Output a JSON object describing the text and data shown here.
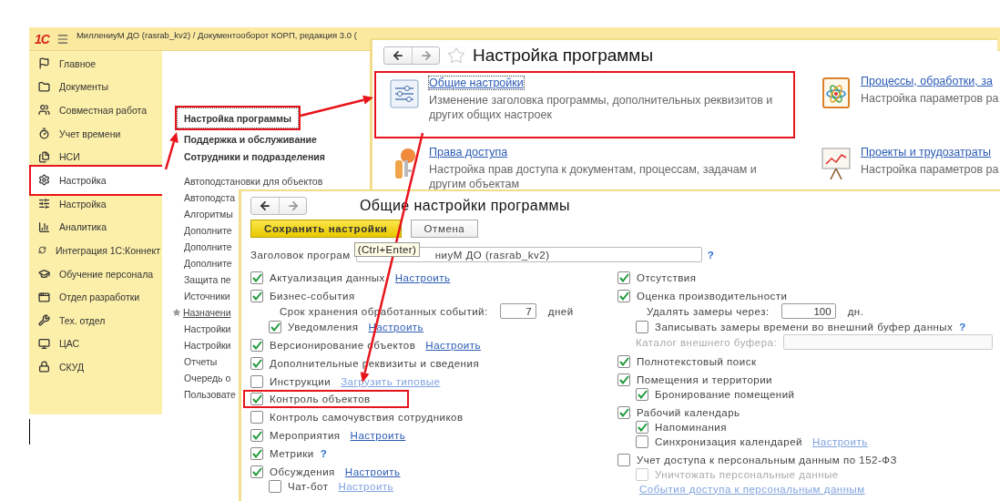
{
  "app": {
    "logo": "1С",
    "title": "МиллениуМ ДО (rasrab_kv2) / Документооборот КОРП, редакция 3.0 ("
  },
  "sidebar": {
    "items": [
      {
        "label": "Главное",
        "selected": false,
        "annotated": false
      },
      {
        "label": "Документы",
        "selected": false,
        "annotated": false
      },
      {
        "label": "Совместная работа",
        "selected": false,
        "annotated": false
      },
      {
        "label": "Учет времени",
        "selected": false,
        "annotated": false
      },
      {
        "label": "НСИ",
        "selected": false,
        "annotated": false
      },
      {
        "label": "Настройка",
        "selected": true,
        "annotated": true
      },
      {
        "label": "Настройка",
        "selected": false,
        "annotated": false
      },
      {
        "label": "Аналитика",
        "selected": false,
        "annotated": false
      },
      {
        "label": "Интеграция 1С:Коннект",
        "selected": false,
        "annotated": false
      },
      {
        "label": "Обучение персонала",
        "selected": false,
        "annotated": false
      },
      {
        "label": "Отдел разработки",
        "selected": false,
        "annotated": false
      },
      {
        "label": "Тех. отдел",
        "selected": false,
        "annotated": false
      },
      {
        "label": "ЦАС",
        "selected": false,
        "annotated": false
      },
      {
        "label": "СКУД",
        "selected": false,
        "annotated": false
      }
    ]
  },
  "sections": [
    {
      "label": "Настройка программы",
      "selected": true,
      "annotated": true
    },
    {
      "label": "Поддержка и обслуживание",
      "selected": false,
      "annotated": false
    },
    {
      "label": "Сотрудники и подразделения",
      "selected": false,
      "annotated": false
    }
  ],
  "section_links": [
    {
      "label": "Автоподстановки для объектов",
      "starred": false
    },
    {
      "label": "Автоподста",
      "starred": false
    },
    {
      "label": "Алгоритмы",
      "starred": false
    },
    {
      "label": "Дополните",
      "starred": false
    },
    {
      "label": "Дополните",
      "starred": false
    },
    {
      "label": "Дополните",
      "starred": false
    },
    {
      "label": "Защита пе",
      "starred": false
    },
    {
      "label": "Источники",
      "starred": false
    },
    {
      "label": "Назначени",
      "starred": true
    },
    {
      "label": "Настройки",
      "starred": false
    },
    {
      "label": "Настройки",
      "starred": false
    },
    {
      "label": "Отчеты",
      "starred": false
    },
    {
      "label": "Очередь о",
      "starred": false
    },
    {
      "label": "Пользовате",
      "starred": false
    }
  ],
  "settings_page": {
    "title": "Настройка программы",
    "items": [
      {
        "title": "Общие настройки",
        "description": "Изменение заголовка программы, дополнительных реквизитов и других общих настроек",
        "selected": true,
        "annotated": true
      },
      {
        "title": "Процессы, обработки, за",
        "description": "Настройка параметров ра",
        "selected": false,
        "annotated": false
      },
      {
        "title": "Права доступа",
        "description": "Настройка прав доступа к документам, процессам, задачам и другим объектам",
        "selected": false,
        "annotated": false
      },
      {
        "title": "Проекты и трудозатраты",
        "description": "Настройка параметров ра",
        "selected": false,
        "annotated": false
      }
    ]
  },
  "dialog": {
    "title": "Общие настройки программы",
    "save_button": "Сохранить настройки",
    "cancel_button": "Отмена",
    "tooltip": "(Ctrl+Enter)",
    "title_field": {
      "label": "Заголовок програм",
      "value": "ниуМ ДО (rasrab_kv2)",
      "help": "?"
    },
    "left_column": [
      {
        "kind": "checkbox",
        "label": "Актуализация данных",
        "checked": true,
        "link": {
          "text": "Настроить",
          "disabled": false
        }
      },
      {
        "kind": "checkbox",
        "label": "Бизнес-события",
        "checked": true,
        "children": [
          {
            "kind": "number",
            "label": "Срок хранения обработанных событий:",
            "value": "7",
            "unit": "дней"
          },
          {
            "kind": "checkbox",
            "label": "Уведомления",
            "checked": true,
            "link": {
              "text": "Настроить",
              "disabled": false
            }
          }
        ]
      },
      {
        "kind": "checkbox",
        "label": "Версионирование объектов",
        "checked": true,
        "link": {
          "text": "Настроить",
          "disabled": false
        }
      },
      {
        "kind": "checkbox",
        "label": "Дополнительные реквизиты и сведения",
        "checked": true
      },
      {
        "kind": "checkbox",
        "label": "Инструкции",
        "checked": false,
        "link": {
          "text": "Загрузить типовые",
          "disabled": true
        }
      },
      {
        "kind": "checkbox",
        "label": "Контроль объектов",
        "checked": true,
        "annotated": true
      },
      {
        "kind": "checkbox",
        "label": "Контроль самочувствия сотрудников",
        "checked": false
      },
      {
        "kind": "checkbox",
        "label": "Мероприятия",
        "checked": true,
        "link": {
          "text": "Настроить",
          "disabled": false
        }
      },
      {
        "kind": "checkbox",
        "label": "Метрики",
        "checked": true,
        "help": "?"
      },
      {
        "kind": "checkbox",
        "label": "Обсуждения",
        "checked": true,
        "link": {
          "text": "Настроить",
          "disabled": false
        },
        "children": [
          {
            "kind": "checkbox",
            "label": "Чат-бот",
            "checked": false,
            "link": {
              "text": "Настроить",
              "disabled": true
            }
          }
        ]
      }
    ],
    "right_column": [
      {
        "kind": "checkbox",
        "label": "Отсутствия",
        "checked": true
      },
      {
        "kind": "checkbox",
        "label": "Оценка производительности",
        "checked": true,
        "children": [
          {
            "kind": "number",
            "label": "Удалять замеры через:",
            "value": "100",
            "unit": "дн."
          },
          {
            "kind": "checkbox",
            "label": "Записывать замеры времени во внешний буфер данных",
            "checked": false,
            "help": "?"
          },
          {
            "kind": "field",
            "label": "Каталог внешнего буфера:",
            "disabled": true
          }
        ]
      },
      {
        "kind": "checkbox",
        "label": "Полнотекстовый поиск",
        "checked": true
      },
      {
        "kind": "checkbox",
        "label": "Помещения и территории",
        "checked": true,
        "children": [
          {
            "kind": "checkbox",
            "label": "Бронирование помещений",
            "checked": true
          }
        ]
      },
      {
        "kind": "checkbox",
        "label": "Рабочий календарь",
        "checked": true,
        "children": [
          {
            "kind": "checkbox",
            "label": "Напоминания",
            "checked": true
          },
          {
            "kind": "checkbox",
            "label": "Синхронизация календарей",
            "checked": false,
            "link": {
              "text": "Настроить",
              "disabled": true
            }
          }
        ]
      },
      {
        "kind": "checkbox",
        "label": "Учет доступа к персональным данным по 152-ФЗ",
        "checked": false,
        "children": [
          {
            "kind": "checkbox",
            "label": "Уничтожать персональные данные",
            "checked": false,
            "disabled": true
          },
          {
            "kind": "link",
            "link": {
              "text": "События доступа к персональным данным",
              "disabled": true
            }
          }
        ]
      }
    ]
  }
}
